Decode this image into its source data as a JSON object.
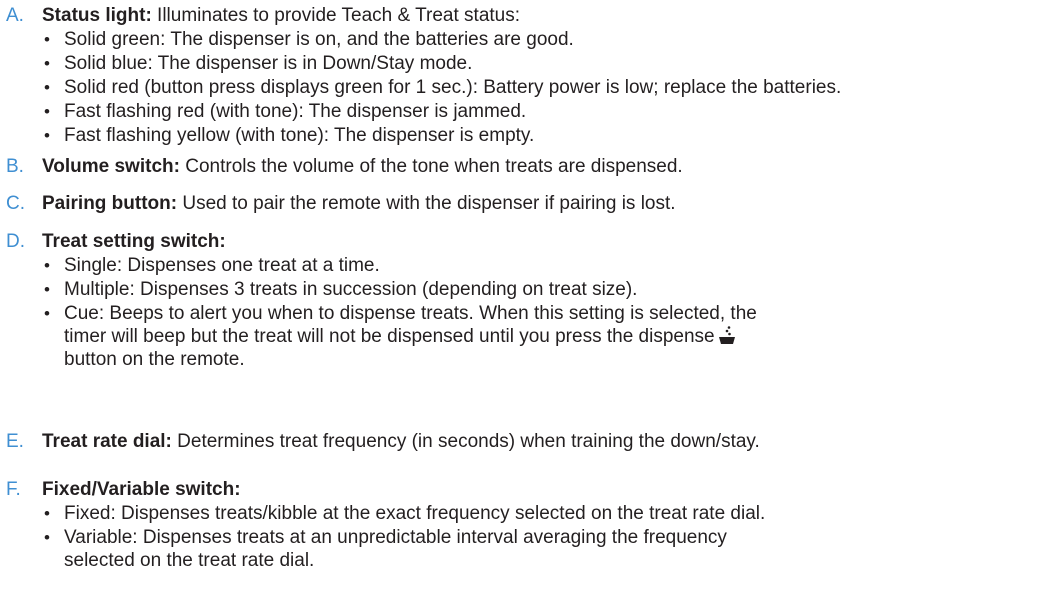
{
  "items": [
    {
      "letter": "A.",
      "title": "Status light:",
      "desc": " Illuminates to provide Teach & Treat status:",
      "bullets": [
        "Solid green: The dispenser is on, and the batteries are good.",
        "Solid blue: The dispenser is in Down/Stay mode.",
        "Solid red (button press displays green for 1 sec.): Battery power is low; replace the batteries.",
        "Fast flashing red (with tone): The dispenser is jammed.",
        "Fast flashing yellow (with tone): The dispenser is empty."
      ]
    },
    {
      "letter": "B.",
      "title": "Volume switch:",
      "desc": " Controls the volume of the tone when treats are dispensed."
    },
    {
      "letter": "C.",
      "title": "Pairing button:",
      "desc": " Used to pair the remote with the dispenser if pairing is lost."
    },
    {
      "letter": "D.",
      "title": "Treat setting switch:",
      "desc": "",
      "bullets": [
        "Single: Dispenses one treat at a time.",
        "Multiple: Dispenses 3 treats in succession (depending on treat size)."
      ],
      "cue_line1": "Cue: Beeps to alert you when to dispense treats. When this setting is selected, the",
      "cue_line2a": "timer will beep but the treat will not be dispensed until you press the dispense",
      "cue_line3": "button on the remote.",
      "cue_icon": "dispense-bowl-icon"
    },
    {
      "letter": "E.",
      "title": "Treat rate dial:",
      "desc": " Determines treat frequency (in seconds) when training the down/stay."
    },
    {
      "letter": "F.",
      "title": "Fixed/Variable switch:",
      "desc": "",
      "bullets": [
        "Fixed: Dispenses treats/kibble at the exact frequency selected on the treat rate dial."
      ],
      "variable_line1": "Variable: Dispenses treats at an unpredictable interval averaging the frequency",
      "variable_line2": "selected on the treat rate dial."
    }
  ],
  "colors": {
    "letter": "#3f8fd2",
    "text": "#231f20"
  }
}
